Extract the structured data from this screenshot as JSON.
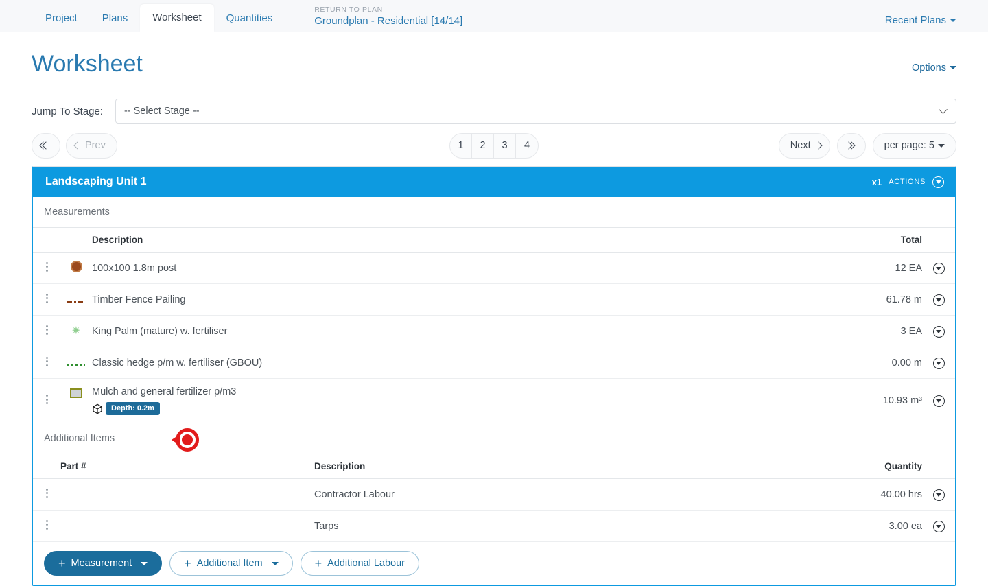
{
  "topnav": {
    "tabs": [
      {
        "label": "Project",
        "active": false
      },
      {
        "label": "Plans",
        "active": false
      },
      {
        "label": "Worksheet",
        "active": true
      },
      {
        "label": "Quantities",
        "active": false
      }
    ],
    "return_label": "RETURN TO PLAN",
    "return_plan": "Groundplan - Residential [14/14]",
    "recent_plans": "Recent Plans"
  },
  "page": {
    "title": "Worksheet",
    "options": "Options"
  },
  "stage": {
    "label": "Jump To Stage:",
    "selected": "-- Select Stage --"
  },
  "pager": {
    "first": "«",
    "prev": "Prev",
    "next": "Next",
    "last": "»",
    "pages": [
      "1",
      "2",
      "3",
      "4"
    ],
    "current_page": "1",
    "per_page": "per page: 5"
  },
  "card": {
    "title": "Landscaping Unit 1",
    "multiplier": "x1",
    "actions_label": "ACTIONS",
    "measurements_label": "Measurements",
    "additional_items_label": "Additional Items",
    "measurements_columns": {
      "description": "Description",
      "total": "Total"
    },
    "measurements": [
      {
        "icon": "circle-marker-icon",
        "description": "100x100 1.8m post",
        "total": "12 EA"
      },
      {
        "icon": "dash-line-icon",
        "description": "Timber Fence Pailing",
        "total": "61.78 m"
      },
      {
        "icon": "star-burst-icon",
        "description": "King Palm (mature) w. fertiliser",
        "total": "3 EA"
      },
      {
        "icon": "dotted-line-icon",
        "description": "Classic hedge p/m w. fertiliser (GBOU)",
        "total": "0.00 m"
      },
      {
        "icon": "area-square-icon",
        "description": "Mulch and general fertilizer p/m3",
        "total": "10.93 m³",
        "badge": "Depth: 0.2m"
      }
    ],
    "additional_columns": {
      "part": "Part #",
      "description": "Description",
      "quantity": "Quantity"
    },
    "additional_items": [
      {
        "part": "",
        "description": "Contractor Labour",
        "quantity": "40.00 hrs"
      },
      {
        "part": "",
        "description": "Tarps",
        "quantity": "3.00 ea"
      }
    ],
    "footer_buttons": [
      {
        "label": "Measurement",
        "style": "primary",
        "caret": true
      },
      {
        "label": "Additional Item",
        "style": "outline",
        "caret": true
      },
      {
        "label": "Additional Labour",
        "style": "outline",
        "caret": false
      }
    ]
  },
  "colors": {
    "accent_blue": "#0d9ae0",
    "link_blue": "#2a7ab0",
    "button_blue": "#1b6d9c",
    "badge_blue": "#1d6b99",
    "marker_red": "#e21b1b"
  }
}
